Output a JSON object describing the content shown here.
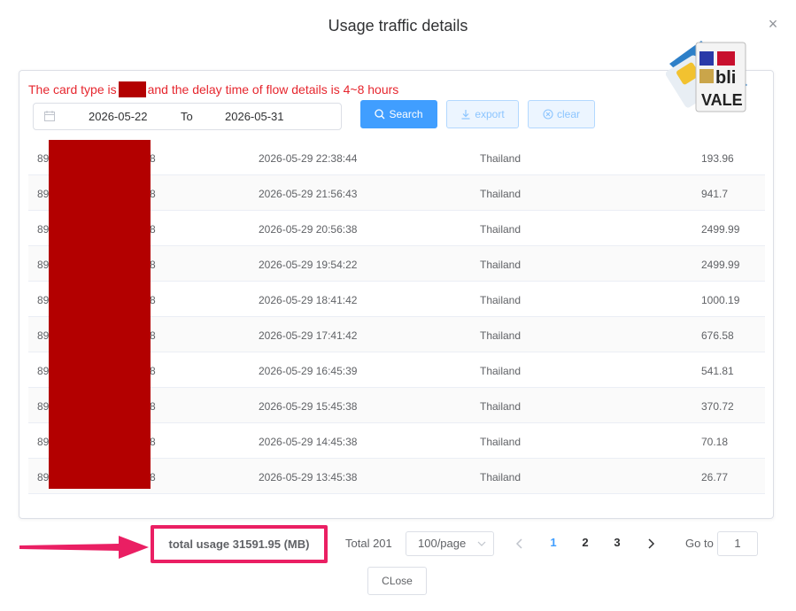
{
  "dialog": {
    "title": "Usage traffic details",
    "close_glyph": "×"
  },
  "notice": {
    "prefix": "The card type is",
    "suffix": "and the delay time of flow details is 4~8 hours"
  },
  "filters": {
    "date_start": "2026-05-22",
    "range_separator": "To",
    "date_end": "2026-05-31",
    "search_label": "Search",
    "export_label": "export",
    "clear_label": "clear"
  },
  "logo": {
    "text_top": "bli",
    "text_bottom": "VALE"
  },
  "table": {
    "rows": [
      {
        "id_start": "89",
        "id_end": "8",
        "time": "2026-05-29 22:38:44",
        "country": "Thailand",
        "usage": "193.96"
      },
      {
        "id_start": "89",
        "id_end": "8",
        "time": "2026-05-29 21:56:43",
        "country": "Thailand",
        "usage": "941.7"
      },
      {
        "id_start": "89",
        "id_end": "8",
        "time": "2026-05-29 20:56:38",
        "country": "Thailand",
        "usage": "2499.99"
      },
      {
        "id_start": "89",
        "id_end": "8",
        "time": "2026-05-29 19:54:22",
        "country": "Thailand",
        "usage": "2499.99"
      },
      {
        "id_start": "89",
        "id_end": "8",
        "time": "2026-05-29 18:41:42",
        "country": "Thailand",
        "usage": "1000.19"
      },
      {
        "id_start": "89",
        "id_end": "8",
        "time": "2026-05-29 17:41:42",
        "country": "Thailand",
        "usage": "676.58"
      },
      {
        "id_start": "89",
        "id_end": "8",
        "time": "2026-05-29 16:45:39",
        "country": "Thailand",
        "usage": "541.81"
      },
      {
        "id_start": "89",
        "id_end": "8",
        "time": "2026-05-29 15:45:38",
        "country": "Thailand",
        "usage": "370.72"
      },
      {
        "id_start": "89",
        "id_end": "8",
        "time": "2026-05-29 14:45:38",
        "country": "Thailand",
        "usage": "70.18"
      },
      {
        "id_start": "89",
        "id_end": "8",
        "time": "2026-05-29 13:45:38",
        "country": "Thailand",
        "usage": "26.77"
      }
    ]
  },
  "footer": {
    "total_usage": "total usage 31591.95 (MB)",
    "total_count": "Total 201",
    "page_size": "100/page",
    "pages": [
      "1",
      "2",
      "3"
    ],
    "active_page": "1",
    "goto_label": "Go to",
    "goto_value": "1",
    "close_label": "CLose"
  },
  "colors": {
    "accent": "#409eff",
    "notice": "#e6262e",
    "redaction": "#b30000",
    "highlight": "#ea1f63"
  },
  "icons": [
    "close-icon",
    "calendar-icon",
    "search-icon",
    "download-icon",
    "clear-circle-icon",
    "chevron-down-icon",
    "chevron-left-icon",
    "chevron-right-icon",
    "arrow-icon",
    "sim-card-icon"
  ]
}
